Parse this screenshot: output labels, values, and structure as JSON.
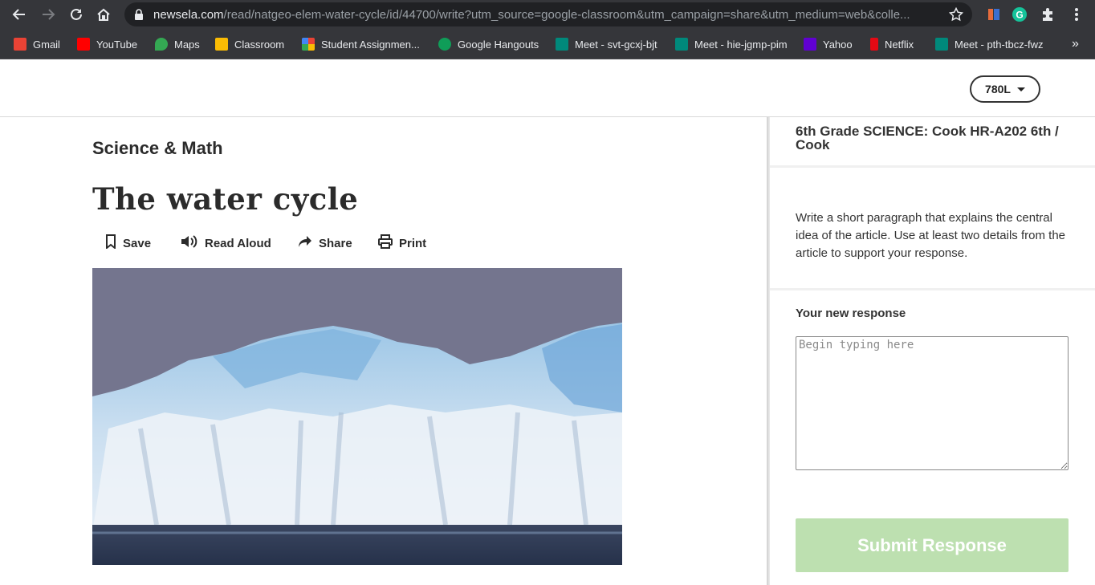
{
  "browser": {
    "url_host": "newsela.com",
    "url_path": "/read/natgeo-elem-water-cycle/id/44700/write?utm_source=google-classroom&utm_campaign=share&utm_medium=web&colle...",
    "bookmarks": [
      {
        "label": "Gmail",
        "color": "#ea4335"
      },
      {
        "label": "YouTube",
        "color": "#ff0000"
      },
      {
        "label": "Maps",
        "color": "#34a853"
      },
      {
        "label": "Classroom",
        "color": "#fbbc04"
      },
      {
        "label": "Student Assignmen...",
        "color": "#f4b400"
      },
      {
        "label": "Google Hangouts",
        "color": "#0f9d58"
      },
      {
        "label": "Meet - svt-gcxj-bjt",
        "color": "#00897b"
      },
      {
        "label": "Meet - hie-jgmp-pim",
        "color": "#00897b"
      },
      {
        "label": "Yahoo",
        "color": "#6001d2"
      },
      {
        "label": "Netflix",
        "color": "#e50914"
      },
      {
        "label": "Meet - pth-tbcz-fwz",
        "color": "#00897b"
      }
    ],
    "more_bookmarks": "»"
  },
  "header": {
    "reading_level": "780L"
  },
  "article": {
    "category": "Science & Math",
    "title": "The water cycle",
    "tools": {
      "save": "Save",
      "read_aloud": "Read Aloud",
      "share": "Share",
      "print": "Print"
    }
  },
  "panel": {
    "class_name": "6th Grade SCIENCE: Cook HR-A202 6th / Cook",
    "prompt": "Write a short paragraph that explains the central idea of the article. Use at least two details from the article to support your response.",
    "response_label": "Your new response",
    "response_placeholder": "Begin typing here",
    "response_value": "",
    "submit_label": "Submit Response"
  },
  "colors": {
    "submit_disabled": "#bde0b0",
    "chrome_bg": "#35363a"
  }
}
